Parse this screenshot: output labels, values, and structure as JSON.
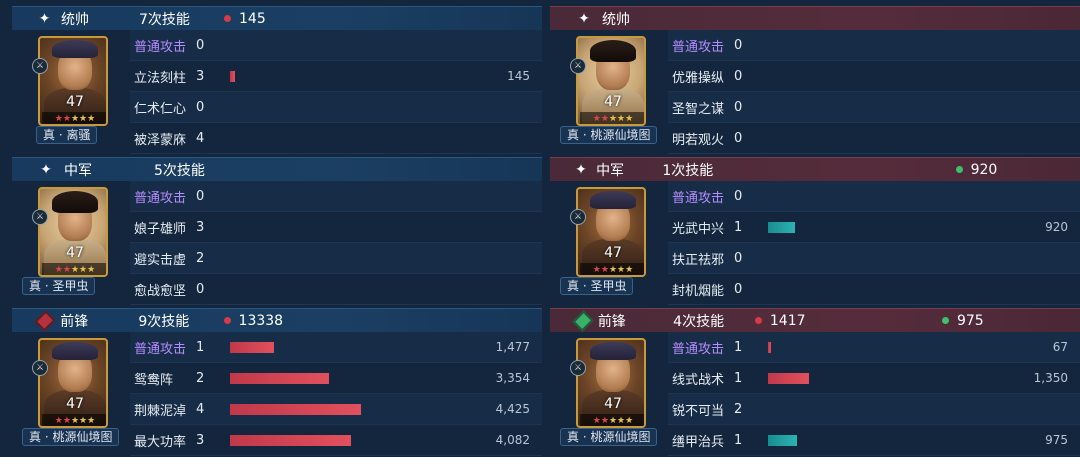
{
  "left": {
    "sections": [
      {
        "role": "统帅",
        "role_marker": "star",
        "casts": "7次技能",
        "stat1": {
          "color": "red",
          "value": "145"
        },
        "stat2": null,
        "level": "47",
        "tag": "真 · 离骚",
        "portrait": "male",
        "rows": [
          {
            "skill": "普通攻击",
            "purple": true,
            "count": "0",
            "bar": 0,
            "bar_color": "red",
            "value": ""
          },
          {
            "skill": "立法刻柱",
            "purple": false,
            "count": "3",
            "bar": 0.03,
            "bar_color": "red",
            "value": "145"
          },
          {
            "skill": "仁术仁心",
            "purple": false,
            "count": "0",
            "bar": 0,
            "bar_color": "red",
            "value": ""
          },
          {
            "skill": "被泽蒙庥",
            "purple": false,
            "count": "4",
            "bar": 0,
            "bar_color": "red",
            "value": ""
          }
        ]
      },
      {
        "role": "中军",
        "role_marker": "star",
        "casts": "5次技能",
        "stat1": null,
        "stat2": null,
        "level": "47",
        "tag": "真 · 圣甲虫",
        "portrait": "female",
        "rows": [
          {
            "skill": "普通攻击",
            "purple": true,
            "count": "0",
            "bar": 0,
            "bar_color": "red",
            "value": ""
          },
          {
            "skill": "娘子雄师",
            "purple": false,
            "count": "3",
            "bar": 0,
            "bar_color": "red",
            "value": ""
          },
          {
            "skill": "避实击虚",
            "purple": false,
            "count": "2",
            "bar": 0,
            "bar_color": "red",
            "value": ""
          },
          {
            "skill": "愈战愈坚",
            "purple": false,
            "count": "0",
            "bar": 0,
            "bar_color": "red",
            "value": ""
          }
        ]
      },
      {
        "role": "前锋",
        "role_marker": "red-diamond",
        "casts": "9次技能",
        "stat1": {
          "color": "red",
          "value": "13338"
        },
        "stat2": null,
        "level": "47",
        "tag": "真 · 桃源仙境图",
        "portrait": "male",
        "rows": [
          {
            "skill": "普通攻击",
            "purple": true,
            "count": "1",
            "bar": 0.26,
            "bar_color": "red",
            "value": "1,477"
          },
          {
            "skill": "鸳鸯阵",
            "purple": false,
            "count": "2",
            "bar": 0.58,
            "bar_color": "red",
            "value": "3,354"
          },
          {
            "skill": "荆棘泥淖",
            "purple": false,
            "count": "4",
            "bar": 0.77,
            "bar_color": "red",
            "value": "4,425"
          },
          {
            "skill": "最大功率",
            "purple": false,
            "count": "3",
            "bar": 0.71,
            "bar_color": "red",
            "value": "4,082"
          }
        ]
      }
    ]
  },
  "right": {
    "sections": [
      {
        "role": "统帅",
        "role_marker": "star",
        "casts": "",
        "stat1": null,
        "stat2": null,
        "level": "47",
        "tag": "真 · 桃源仙境图",
        "portrait": "female",
        "rows": [
          {
            "skill": "普通攻击",
            "purple": true,
            "count": "0",
            "bar": 0,
            "bar_color": "teal",
            "value": ""
          },
          {
            "skill": "优雅操纵",
            "purple": false,
            "count": "0",
            "bar": 0,
            "bar_color": "teal",
            "value": ""
          },
          {
            "skill": "圣智之谋",
            "purple": false,
            "count": "0",
            "bar": 0,
            "bar_color": "teal",
            "value": ""
          },
          {
            "skill": "明若观火",
            "purple": false,
            "count": "0",
            "bar": 0,
            "bar_color": "teal",
            "value": ""
          }
        ]
      },
      {
        "role": "中军",
        "role_marker": "star",
        "casts": "1次技能",
        "stat1": null,
        "stat2": {
          "color": "green",
          "value": "920"
        },
        "level": "47",
        "tag": "真 · 圣甲虫",
        "portrait": "male",
        "rows": [
          {
            "skill": "普通攻击",
            "purple": true,
            "count": "0",
            "bar": 0,
            "bar_color": "teal",
            "value": ""
          },
          {
            "skill": "光武中兴",
            "purple": false,
            "count": "1",
            "bar": 0.16,
            "bar_color": "teal",
            "value": "920"
          },
          {
            "skill": "扶正祛邪",
            "purple": false,
            "count": "0",
            "bar": 0,
            "bar_color": "teal",
            "value": ""
          },
          {
            "skill": "封机烟能",
            "purple": false,
            "count": "0",
            "bar": 0,
            "bar_color": "teal",
            "value": ""
          }
        ]
      },
      {
        "role": "前锋",
        "role_marker": "green-diamond",
        "casts": "4次技能",
        "stat1": {
          "color": "red",
          "value": "1417"
        },
        "stat2": {
          "color": "green",
          "value": "975"
        },
        "level": "47",
        "tag": "真 · 桃源仙境图",
        "portrait": "male",
        "rows": [
          {
            "skill": "普通攻击",
            "purple": true,
            "count": "1",
            "bar": 0.012,
            "bar_color": "red",
            "value": "67"
          },
          {
            "skill": "线式战术",
            "purple": false,
            "count": "1",
            "bar": 0.24,
            "bar_color": "red",
            "value": "1,350"
          },
          {
            "skill": "锐不可当",
            "purple": false,
            "count": "2",
            "bar": 0,
            "bar_color": "red",
            "value": ""
          },
          {
            "skill": "缮甲治兵",
            "purple": false,
            "count": "1",
            "bar": 0.17,
            "bar_color": "teal",
            "value": "975"
          }
        ]
      }
    ]
  },
  "colors": {
    "header_blue": "#173a5e",
    "header_red": "#552c3b",
    "damage_red": "#d63a48",
    "heal_green": "#3dbf6c",
    "purple_skill": "#b58cff",
    "frame_gold": "#c99a3b"
  },
  "stars": {
    "red": 2,
    "gold": 3
  }
}
